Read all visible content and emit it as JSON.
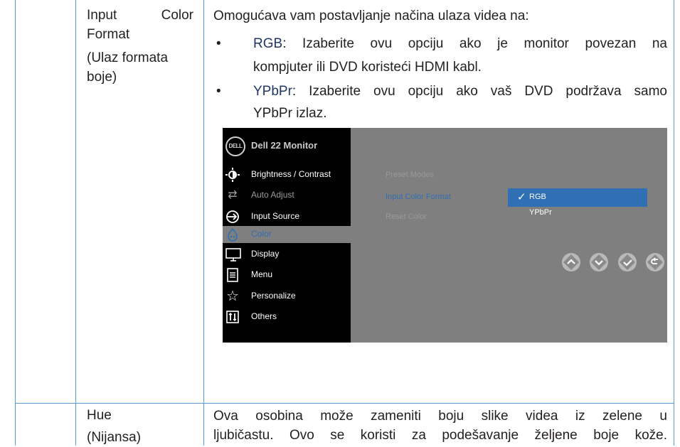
{
  "row1": {
    "label_line1_left": "Input",
    "label_line1_right": "Color",
    "label_line2": "Format",
    "label_line3": "(Ulaz formata",
    "label_line4": "boje)",
    "intro": "Omogućava vam postavljanje načina ulaza videa na:",
    "bullets": [
      {
        "term": "RGB",
        "line1": ": Izaberite ovu opciju ako je monitor povezan na",
        "line2": "kompjuter ili DVD koristeći HDMI kabl."
      },
      {
        "term": "YPbPr",
        "line1": ": Izaberite ovu opciju ako vaš DVD podržava samo",
        "line2": "YPbPr  izlaz."
      }
    ]
  },
  "osd": {
    "logo": "DELL",
    "title": "Dell 22 Monitor",
    "menu": [
      {
        "label": "Brightness / Contrast",
        "icon": "brightness-icon"
      },
      {
        "label": "Auto Adjust",
        "icon": "auto-adjust-icon"
      },
      {
        "label": "Input Source",
        "icon": "input-source-icon"
      },
      {
        "label": "Color",
        "icon": "color-icon"
      },
      {
        "label": "Display",
        "icon": "display-icon"
      },
      {
        "label": "Menu",
        "icon": "menu-icon"
      },
      {
        "label": "Personalize",
        "icon": "personalize-icon"
      },
      {
        "label": "Others",
        "icon": "others-icon"
      }
    ],
    "submenu": [
      "Preset Modes",
      "Input Color Format",
      "Reset Color"
    ],
    "options": [
      "RGB",
      "YPbPr"
    ],
    "selected_option": "RGB",
    "check": "✓",
    "colors": {
      "highlight": "#2f6fb3",
      "panel": "#7f7f7f",
      "sidebar": "#000000"
    }
  },
  "nav_buttons": [
    "up-icon",
    "down-icon",
    "check-icon",
    "back-icon"
  ],
  "row2": {
    "label_line1": "Hue",
    "label_line2": "(Nijansa)",
    "line1": "Ova osobina može zameniti boju slike videa iz zelene u",
    "line2": "ljubičastu. Ovo se koristi za podešavanje željene boje kože."
  }
}
